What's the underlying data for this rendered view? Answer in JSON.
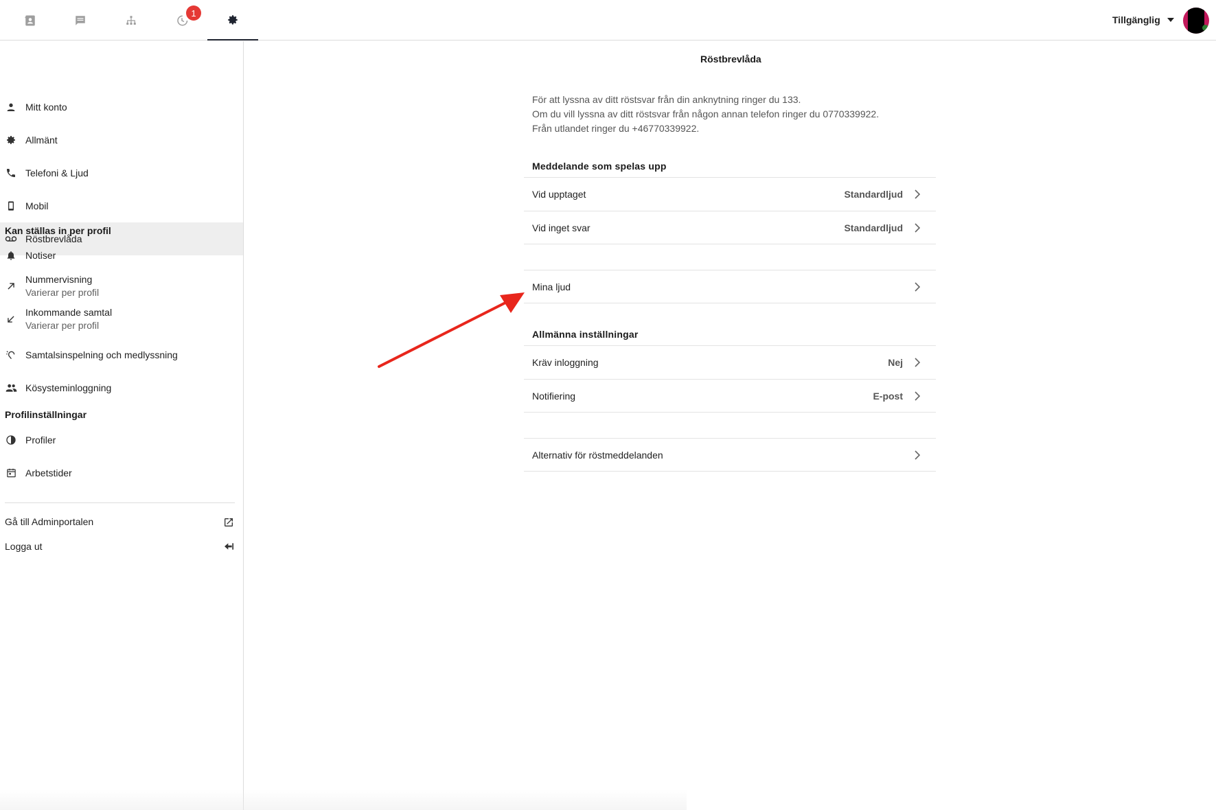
{
  "topbar": {
    "tabs": [
      {
        "name": "contacts",
        "icon": "contacts-icon"
      },
      {
        "name": "messages",
        "icon": "chat-icon"
      },
      {
        "name": "organization",
        "icon": "org-chart-icon"
      },
      {
        "name": "history",
        "icon": "history-icon",
        "badge": "1"
      },
      {
        "name": "settings",
        "icon": "gear-icon",
        "active": true
      }
    ],
    "status_label": "Tillgänglig"
  },
  "sidebar": {
    "items": [
      {
        "label": "Mitt konto",
        "icon": "person-icon"
      },
      {
        "label": "Allmänt",
        "icon": "gear-icon"
      },
      {
        "label": "Telefoni & Ljud",
        "icon": "phone-icon"
      },
      {
        "label": "Mobil",
        "icon": "mobile-icon"
      },
      {
        "label": "Röstbrevlåda",
        "icon": "voicemail-icon",
        "active": true
      }
    ],
    "section_profile": "Kan ställas in per profil",
    "profile_items": [
      {
        "label": "Notiser",
        "icon": "bell-icon"
      },
      {
        "label": "Nummervisning",
        "sub": "Varierar per profil",
        "icon": "outgoing-arrow-icon"
      },
      {
        "label": "Inkommande samtal",
        "sub": "Varierar per profil",
        "icon": "incoming-arrow-icon"
      },
      {
        "label": "Samtalsinspelning och medlyssning",
        "icon": "hearing-icon"
      },
      {
        "label": "Kösysteminloggning",
        "icon": "people-icon"
      }
    ],
    "section_settings": "Profilinställningar",
    "settings_items": [
      {
        "label": "Profiler",
        "icon": "profile-contrast-icon"
      },
      {
        "label": "Arbetstider",
        "icon": "calendar-icon"
      }
    ],
    "admin_link": "Gå till Adminportalen",
    "logout": "Logga ut"
  },
  "main": {
    "title": "Röstbrevlåda",
    "intro_lines": [
      "För att lyssna av ditt röstsvar från din anknytning ringer du 133.",
      "Om du vill lyssna av ditt röstsvar från någon annan telefon ringer du 0770339922.",
      "Från utlandet ringer du +46770339922."
    ],
    "section_messages": "Meddelande som spelas upp",
    "rows_messages": [
      {
        "label": "Vid upptaget",
        "value": "Standardljud"
      },
      {
        "label": "Vid inget svar",
        "value": "Standardljud"
      }
    ],
    "row_sounds": {
      "label": "Mina ljud"
    },
    "section_general": "Allmänna inställningar",
    "rows_general": [
      {
        "label": "Kräv inloggning",
        "value": "Nej"
      },
      {
        "label": "Notifiering",
        "value": "E-post"
      }
    ],
    "row_options": {
      "label": "Alternativ för röstmeddelanden"
    }
  },
  "colors": {
    "accent": "#1f2430",
    "badge": "#e53935",
    "annotation_arrow": "#e8261c",
    "active_bg": "#eeeeee"
  }
}
